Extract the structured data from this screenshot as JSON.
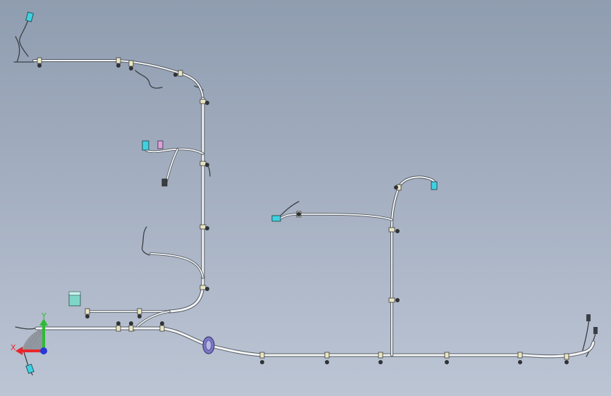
{
  "triad": {
    "x_label": "X",
    "y_label": "Y",
    "x_color": "#e8262a",
    "y_color": "#2dbb35",
    "z_color": "#2838d6"
  },
  "colors": {
    "background_top": "#8f9db0",
    "background_bottom": "#bcc5d4",
    "harness_fill": "#f4f5f6",
    "harness_outline": "#555b63",
    "clip": "#e9e6c4",
    "connector_cyan": "#3fd1e0",
    "connector_magenta": "#d9a3d9",
    "connector_teal": "#7fd6c8",
    "grommet": "#7c78c8"
  }
}
